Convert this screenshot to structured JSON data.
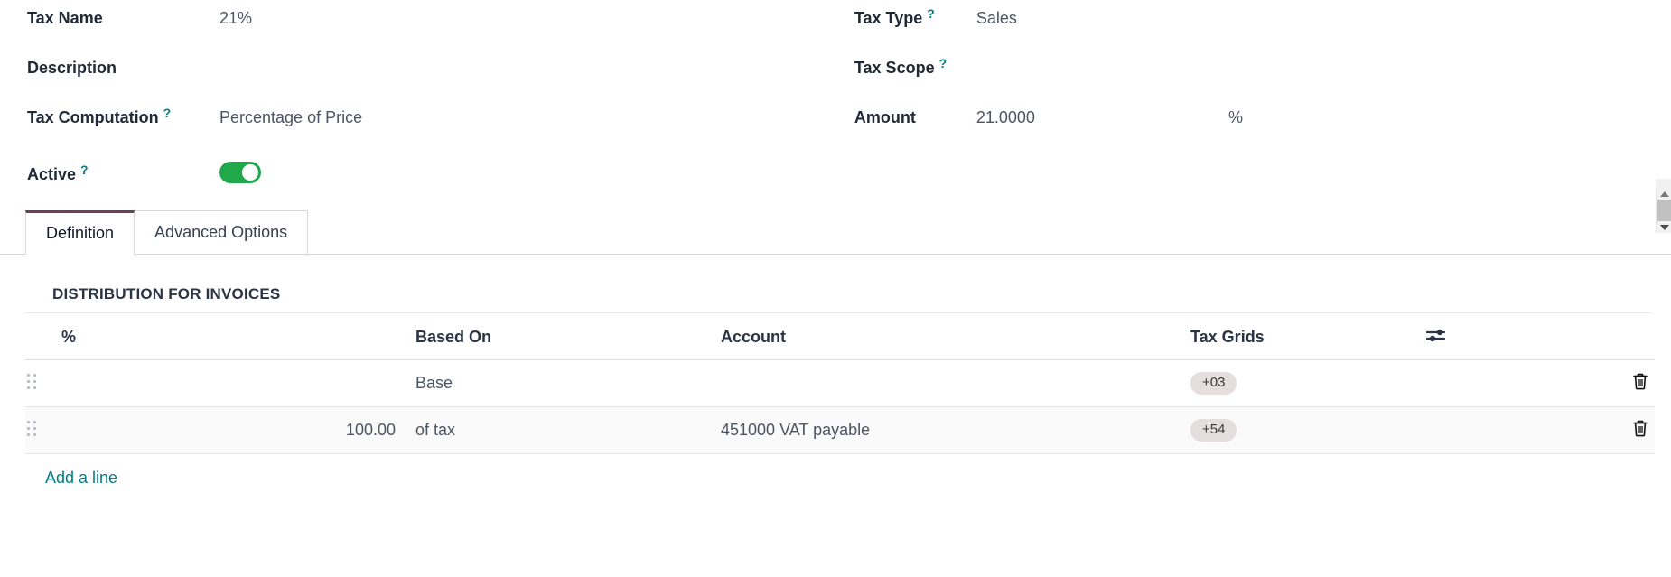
{
  "form": {
    "left_fields": [
      {
        "label": "Tax Name",
        "help": false,
        "value": "21%",
        "type": "text"
      },
      {
        "label": "Description",
        "help": false,
        "value": "",
        "type": "text"
      },
      {
        "label": "Tax Computation",
        "help": true,
        "value": "Percentage of Price",
        "type": "text"
      },
      {
        "label": "Active",
        "help": true,
        "value": "",
        "type": "toggle",
        "toggle_on": true
      }
    ],
    "right_fields": [
      {
        "label": "Tax Type",
        "help": true,
        "value": "Sales",
        "type": "text"
      },
      {
        "label": "Tax Scope",
        "help": true,
        "value": "",
        "type": "text"
      },
      {
        "label": "Amount",
        "help": false,
        "value": "21.0000",
        "type": "text",
        "suffix": "%"
      }
    ],
    "help_marker": "?"
  },
  "tabs": [
    {
      "label": "Definition",
      "active": true
    },
    {
      "label": "Advanced Options",
      "active": false
    }
  ],
  "distribution": {
    "title": "DISTRIBUTION FOR INVOICES",
    "columns": {
      "handle": "",
      "percent": "%",
      "based_on": "Based On",
      "account": "Account",
      "tax_grids": "Tax Grids",
      "options": ""
    },
    "rows": [
      {
        "percent": "",
        "based_on": "Base",
        "account": "",
        "tax_grid": "+03",
        "delete_label": "Delete row"
      },
      {
        "percent": "100.00",
        "based_on": "of tax",
        "account": "451000 VAT payable",
        "tax_grid": "+54",
        "delete_label": "Delete row"
      }
    ],
    "add_line_label": "Add a line"
  },
  "icons": {
    "column_options": "sliders-icon",
    "delete": "trash-icon",
    "drag": "drag-handle-icon"
  },
  "colors": {
    "accent_purple": "#6b3f5e",
    "link_teal": "#017e84",
    "toggle_green": "#21a84b",
    "badge_bg": "#e6dede",
    "text_dark": "#2b3445"
  }
}
